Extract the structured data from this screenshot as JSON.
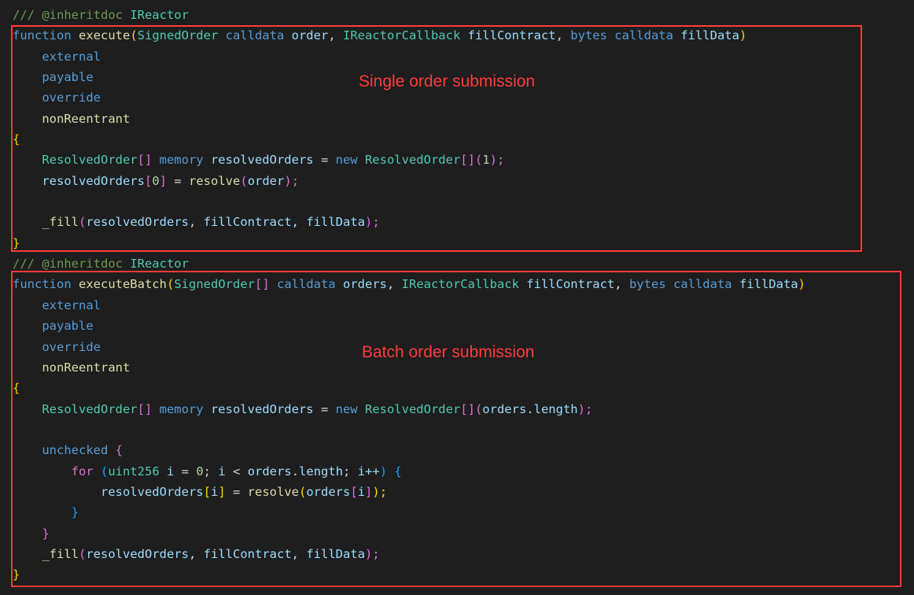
{
  "annotations": {
    "single": "Single order submission",
    "batch": "Batch order submission"
  },
  "block1": {
    "doc_prefix": "/// ",
    "doc_tag": "@inheritdoc",
    "doc_type": " IReactor",
    "fn_kw": "function",
    "fn_name": " execute",
    "paren_open": "(",
    "p1_type": "SignedOrder",
    "p1_loc": " calldata",
    "p1_name": " order",
    "comma1": ", ",
    "p2_type": "IReactorCallback",
    "p2_name": " fillContract",
    "comma2": ", ",
    "p3_type": "bytes",
    "p3_loc": " calldata",
    "p3_name": " fillData",
    "paren_close": ")",
    "mod_external": "    external",
    "mod_payable": "    payable",
    "mod_override": "    override",
    "mod_nonreentrant": "    nonReentrant",
    "brace_open": "{",
    "line_ro_type1": "    ResolvedOrder",
    "line_ro_br1": "[]",
    "line_ro_mem": " memory",
    "line_ro_var": " resolvedOrders ",
    "line_ro_eq": "= ",
    "line_ro_new": "new",
    "line_ro_type2": " ResolvedOrder",
    "line_ro_br2": "[]",
    "line_ro_p1": "(",
    "line_ro_num": "1",
    "line_ro_p2": ");",
    "line_set_var": "    resolvedOrders",
    "line_set_b1": "[",
    "line_set_idx": "0",
    "line_set_b2": "]",
    "line_set_eq": " = ",
    "line_set_fn": "resolve",
    "line_set_p1": "(",
    "line_set_arg": "order",
    "line_set_p2": ");",
    "blank": " ",
    "fill_name": "    _fill",
    "fill_p1": "(",
    "fill_a1": "resolvedOrders",
    "fill_c1": ", ",
    "fill_a2": "fillContract",
    "fill_c2": ", ",
    "fill_a3": "fillData",
    "fill_p2": ");",
    "brace_close": "}"
  },
  "block2": {
    "doc_prefix": "/// ",
    "doc_tag": "@inheritdoc",
    "doc_type": " IReactor",
    "fn_kw": "function",
    "fn_name": " executeBatch",
    "paren_open": "(",
    "p1_type": "SignedOrder",
    "p1_br": "[]",
    "p1_loc": " calldata",
    "p1_name": " orders",
    "comma1": ", ",
    "p2_type": "IReactorCallback",
    "p2_name": " fillContract",
    "comma2": ", ",
    "p3_type": "bytes",
    "p3_loc": " calldata",
    "p3_name": " fillData",
    "paren_close": ")",
    "mod_external": "    external",
    "mod_payable": "    payable",
    "mod_override": "    override",
    "mod_nonreentrant": "    nonReentrant",
    "brace_open": "{",
    "line_ro_type1": "    ResolvedOrder",
    "line_ro_br1": "[]",
    "line_ro_mem": " memory",
    "line_ro_var": " resolvedOrders ",
    "line_ro_eq": "= ",
    "line_ro_new": "new",
    "line_ro_type2": " ResolvedOrder",
    "line_ro_br2": "[]",
    "line_ro_p1": "(",
    "line_ro_arg": "orders",
    "line_ro_dot": ".",
    "line_ro_len": "length",
    "line_ro_p2": ");",
    "blank": " ",
    "unchecked_kw": "    unchecked",
    "unchecked_brace": " {",
    "for_indent": "        ",
    "for_kw": "for",
    "for_open": " (",
    "for_type": "uint256",
    "for_var": " i ",
    "for_eq": "= ",
    "for_zero": "0",
    "for_sc1": "; ",
    "for_i2": "i ",
    "for_lt": "< ",
    "for_ord": "orders",
    "for_dot": ".",
    "for_len": "length",
    "for_sc2": "; ",
    "for_inc": "i++",
    "for_close": ")",
    "for_brace": " {",
    "body_indent": "            ",
    "body_var": "resolvedOrders",
    "body_b1": "[",
    "body_i": "i",
    "body_b2": "]",
    "body_eq": " = ",
    "body_fn": "resolve",
    "body_p1": "(",
    "body_arg": "orders",
    "body_b3": "[",
    "body_i2": "i",
    "body_b4": "]",
    "body_p2": ");",
    "for_close_brace": "        }",
    "unchecked_close": "    }",
    "fill_name": "    _fill",
    "fill_p1": "(",
    "fill_a1": "resolvedOrders",
    "fill_c1": ", ",
    "fill_a2": "fillContract",
    "fill_c2": ", ",
    "fill_a3": "fillData",
    "fill_p2": ");",
    "brace_close": "}"
  }
}
